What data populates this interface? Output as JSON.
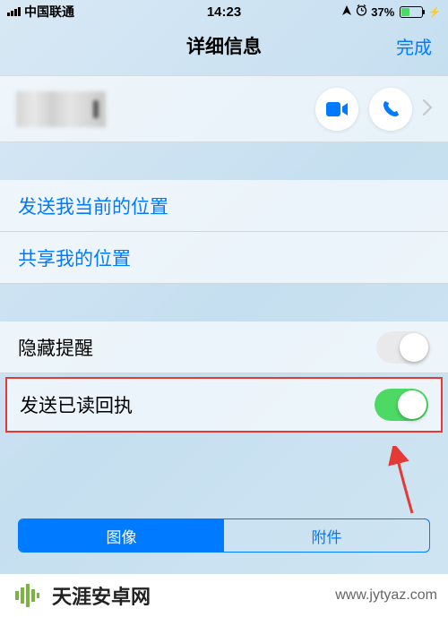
{
  "statusBar": {
    "carrier": "中国联通",
    "time": "14:23",
    "batteryPercent": "37%"
  },
  "navBar": {
    "title": "详细信息",
    "done": "完成"
  },
  "locationSection": {
    "sendCurrent": "发送我当前的位置",
    "shareLocation": "共享我的位置"
  },
  "settingsSection": {
    "hideAlerts": "隐藏提醒",
    "sendReadReceipts": "发送已读回执"
  },
  "tabs": {
    "images": "图像",
    "attachments": "附件"
  },
  "watermark": {
    "siteName": "天涯安卓网",
    "url": "www.jytyaz.com"
  },
  "colors": {
    "accent": "#007aff",
    "toggleOn": "#4cd964",
    "highlight": "#e53935"
  }
}
